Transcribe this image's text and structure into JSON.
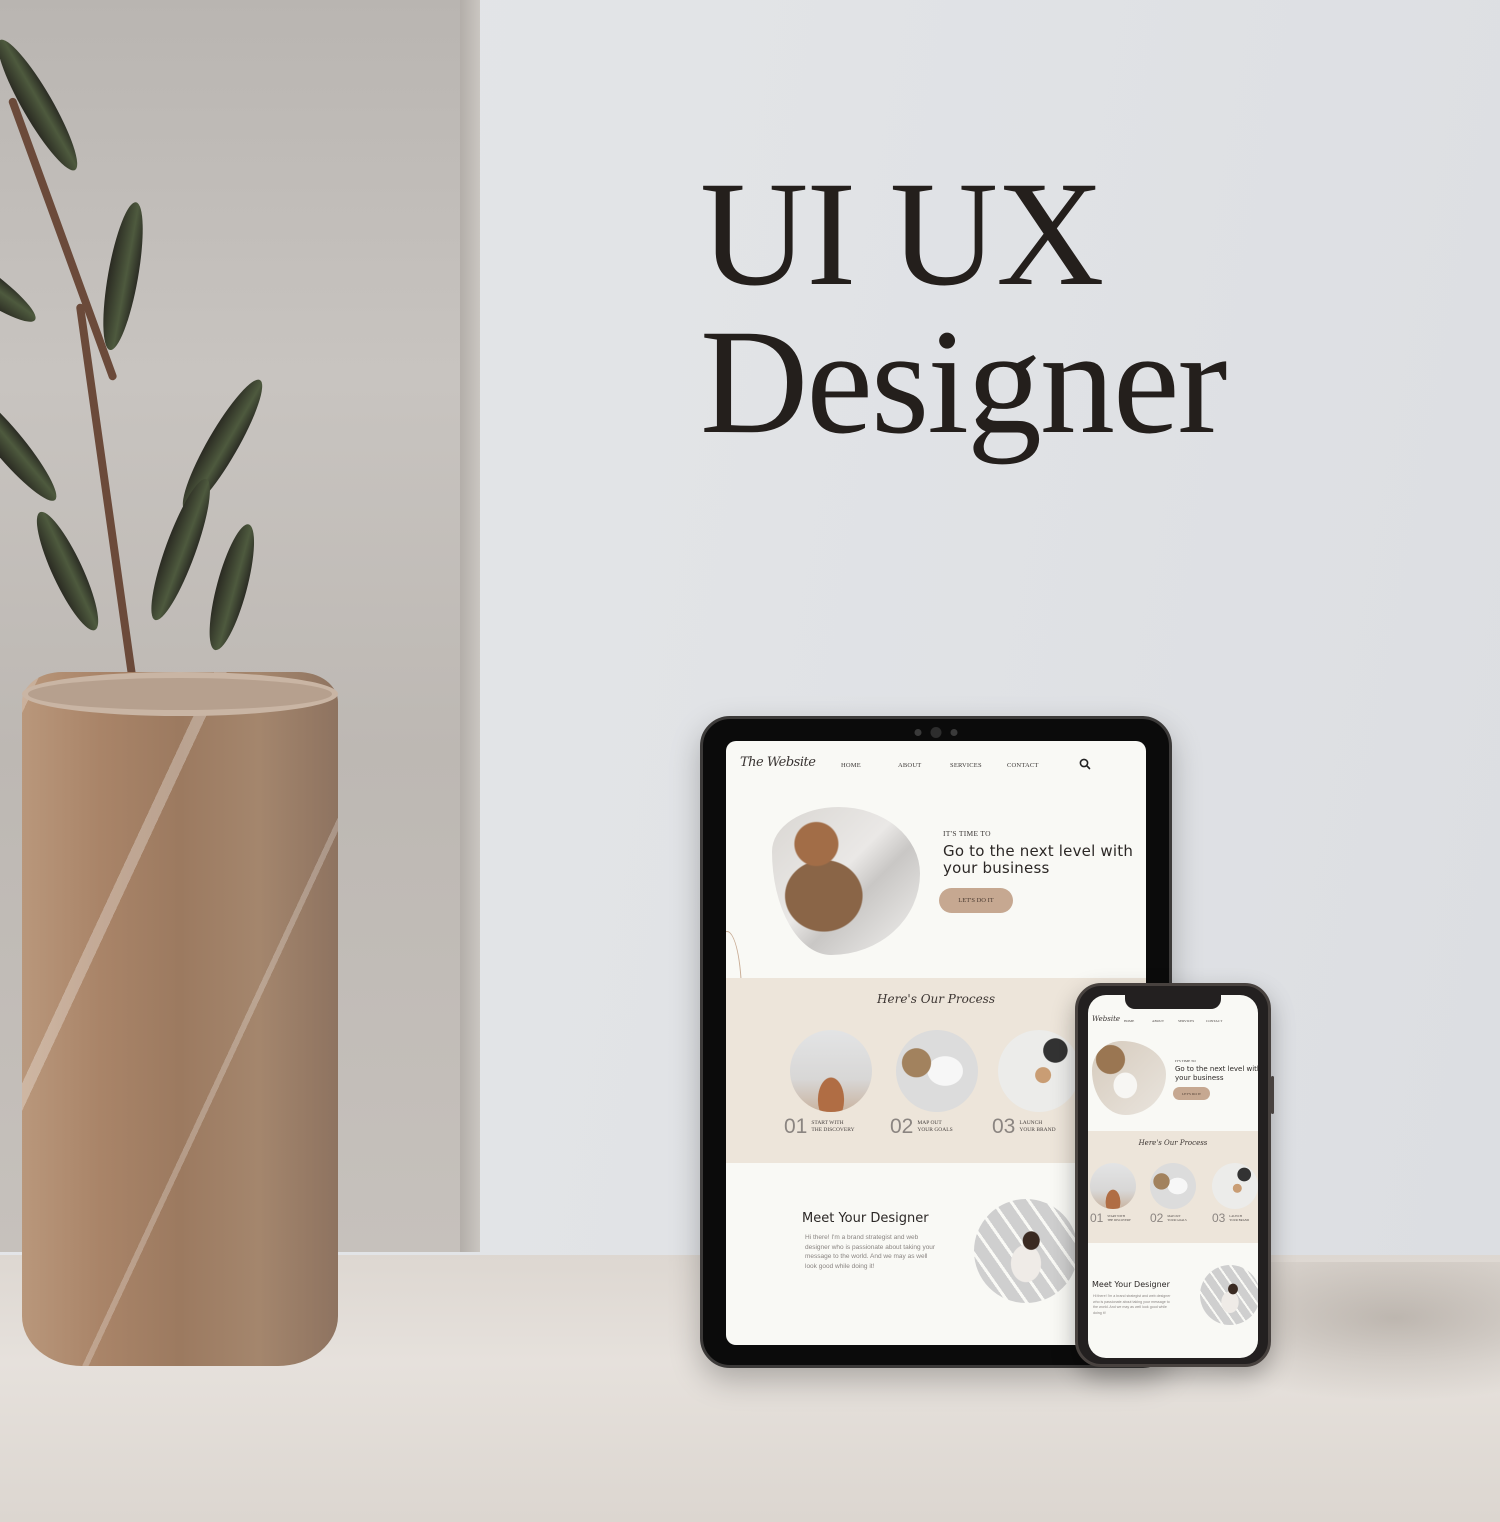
{
  "headline": {
    "line1": "UI UX",
    "line2": "Designer"
  },
  "colors": {
    "accent_button": "#c6a891",
    "process_band": "#ede5da",
    "screen_bg": "#f9f9f5",
    "headline_text": "#241f1c"
  },
  "tablet": {
    "site": {
      "logo": "The Website",
      "nav": [
        "HOME",
        "ABOUT",
        "SERVICES",
        "CONTACT"
      ],
      "search_icon": "search-icon",
      "hero": {
        "kicker": "IT'S TIME TO",
        "title": "Go to the next level with your business",
        "button": "LET'S DO IT"
      },
      "process": {
        "title": "Here's Our Process",
        "steps": [
          {
            "number": "01",
            "line1": "START WITH",
            "line2": "THE DISCOVERY"
          },
          {
            "number": "02",
            "line1": "MAP OUT",
            "line2": "YOUR GOALS"
          },
          {
            "number": "03",
            "line1": "LAUNCH",
            "line2": "YOUR BRAND"
          }
        ]
      },
      "meet": {
        "title": "Meet Your Designer",
        "body": "Hi there! I'm a brand strategist and web designer who is passionate about taking your message to the world. And we may as well look good while doing it!"
      }
    }
  },
  "phone": {
    "site": {
      "logo": "Website",
      "nav": [
        "HOME",
        "ABOUT",
        "SERVICES",
        "CONTACT"
      ],
      "hero": {
        "kicker": "IT'S TIME TO",
        "title": "Go to the next level with your business",
        "button": "LET'S DO IT"
      },
      "process": {
        "title": "Here's Our Process",
        "steps": [
          {
            "number": "01",
            "line1": "START WITH",
            "line2": "THE DISCOVERY"
          },
          {
            "number": "02",
            "line1": "MAP OUT",
            "line2": "YOUR GOALS"
          },
          {
            "number": "03",
            "line1": "LAUNCH",
            "line2": "YOUR BRAND"
          }
        ]
      },
      "meet": {
        "title": "Meet Your Designer",
        "body": "Hi there! I'm a brand strategist and web designer who is passionate about taking your message to the world. And we may as well look good while doing it!"
      }
    }
  }
}
